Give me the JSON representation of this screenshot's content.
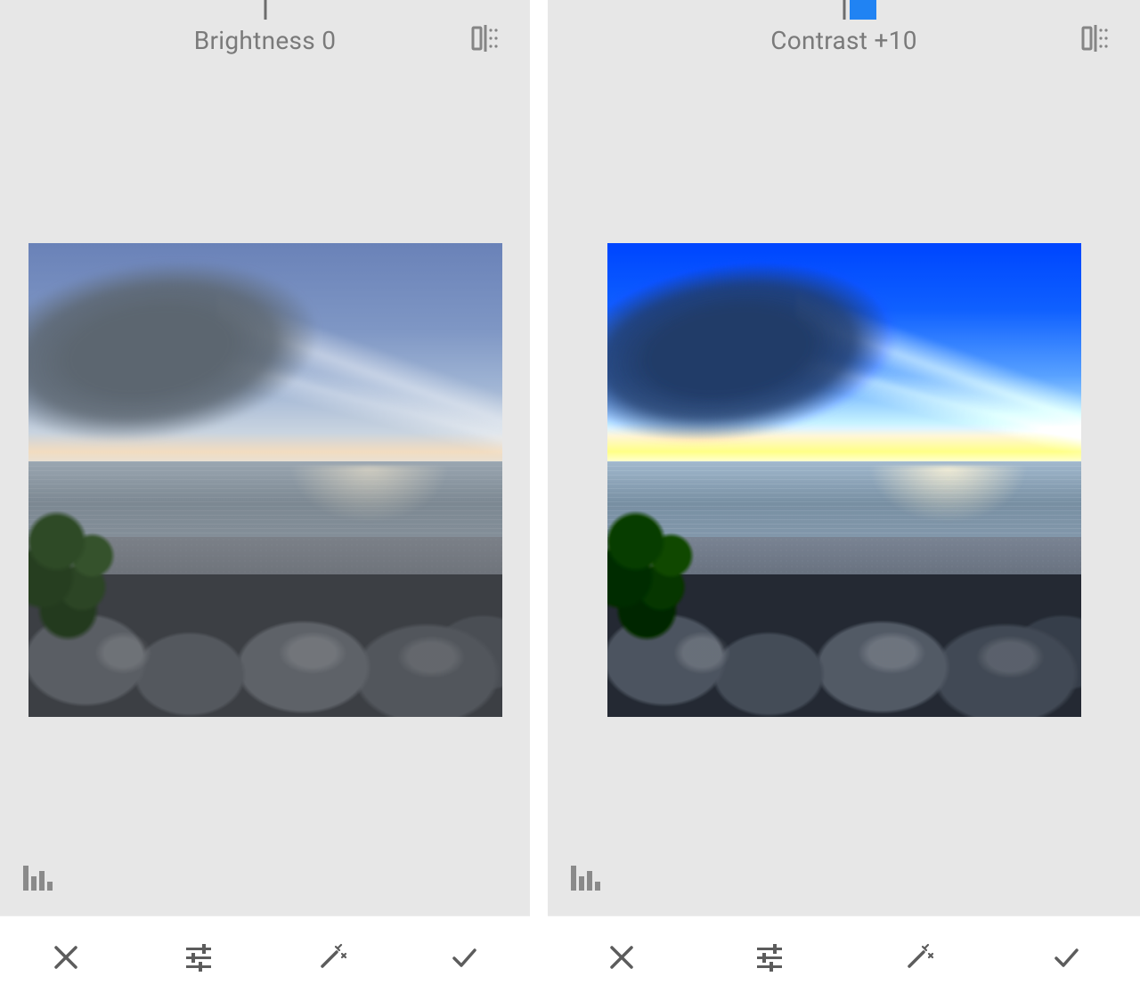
{
  "panels": [
    {
      "adjustment_label": "Brightness 0",
      "adjustment_name": "Brightness",
      "adjustment_value": 0,
      "slider_offset_percent": 50,
      "show_thumb": false
    },
    {
      "adjustment_label": "Contrast +10",
      "adjustment_name": "Contrast",
      "adjustment_value": 10,
      "slider_offset_percent": 50,
      "show_thumb": true,
      "thumb_left_percent": 51
    }
  ],
  "icons": {
    "compare": "compare-icon",
    "histogram": "histogram-icon",
    "close": "close-icon",
    "sliders": "sliders-icon",
    "wand": "wand-icon",
    "apply": "check-icon"
  },
  "colors": {
    "panel_bg": "#e7e7e7",
    "title_text": "#7a7a7a",
    "icon_gray": "#858585",
    "accent_blue": "#2083f3"
  }
}
